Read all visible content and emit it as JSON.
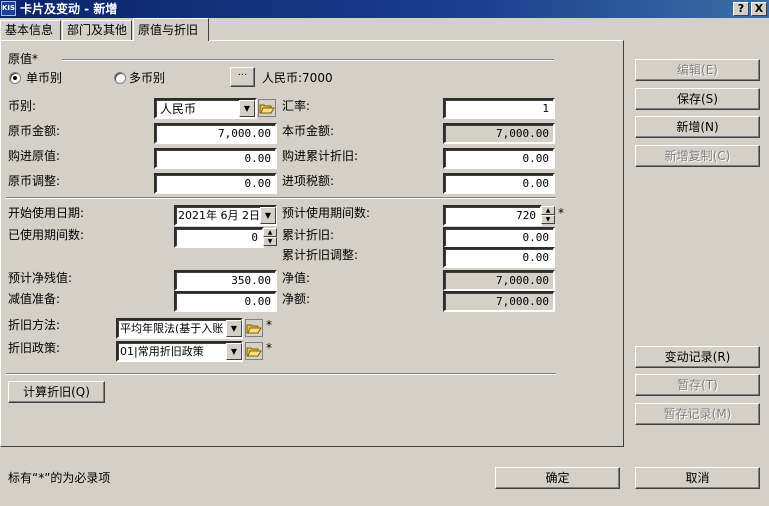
{
  "window": {
    "logo": "KIS",
    "title": "卡片及变动 - 新增",
    "help_btn": "?",
    "close_btn": "X"
  },
  "tabs": [
    {
      "label": "基本信息"
    },
    {
      "label": "部门及其他"
    },
    {
      "label": "原值与折旧",
      "active": true
    }
  ],
  "original_value": {
    "section_label": "原值*",
    "single_currency": "单币别",
    "multi_currency": "多币别",
    "selected_mode": "单币别",
    "more_btn": "···",
    "currency_summary": "人民币:7000",
    "currency_label": "币别:",
    "currency_value": "人民币",
    "exchange_rate_label": "汇率:",
    "exchange_rate": "1",
    "orig_amount_label": "原币金额:",
    "orig_amount": "7,000.00",
    "local_amount_label": "本币金额:",
    "local_amount": "7,000.00",
    "purchase_value_label": "购进原值:",
    "purchase_value": "0.00",
    "purchase_acc_dep_label": "购进累计折旧:",
    "purchase_acc_dep": "0.00",
    "orig_adjust_label": "原币调整:",
    "orig_adjust": "0.00",
    "input_tax_label": "进项税额:",
    "input_tax": "0.00"
  },
  "depreciation": {
    "start_date_label": "开始使用日期:",
    "start_date": "2021年 6月 2日",
    "est_periods_label": "预计使用期间数:",
    "est_periods": "720",
    "used_periods_label": "已使用期间数:",
    "used_periods": "0",
    "acc_dep_label": "累计折旧:",
    "acc_dep": "0.00",
    "acc_dep_adjust_label": "累计折旧调整:",
    "acc_dep_adjust": "0.00",
    "residual_label": "预计净残值:",
    "residual": "350.00",
    "net_value_label": "净值:",
    "net_value": "7,000.00",
    "impairment_label": "减值准备:",
    "impairment": "0.00",
    "net_amount_label": "净额:",
    "net_amount": "7,000.00",
    "method_label": "折旧方法:",
    "method": "平均年限法(基于入账",
    "policy_label": "折旧政策:",
    "policy": "01|常用折旧政策",
    "required_mark": "*",
    "calc_btn": "计算折旧(Q)"
  },
  "side_buttons": {
    "edit": "编辑(E)",
    "save": "保存(S)",
    "new": "新增(N)",
    "new_copy": "新增复制(C)",
    "change_record": "变动记录(R)",
    "hold": "暂存(T)",
    "hold_record": "暂存记录(M)"
  },
  "footer": {
    "note": "标有“*”的为必录项",
    "ok": "确定",
    "cancel": "取消"
  }
}
